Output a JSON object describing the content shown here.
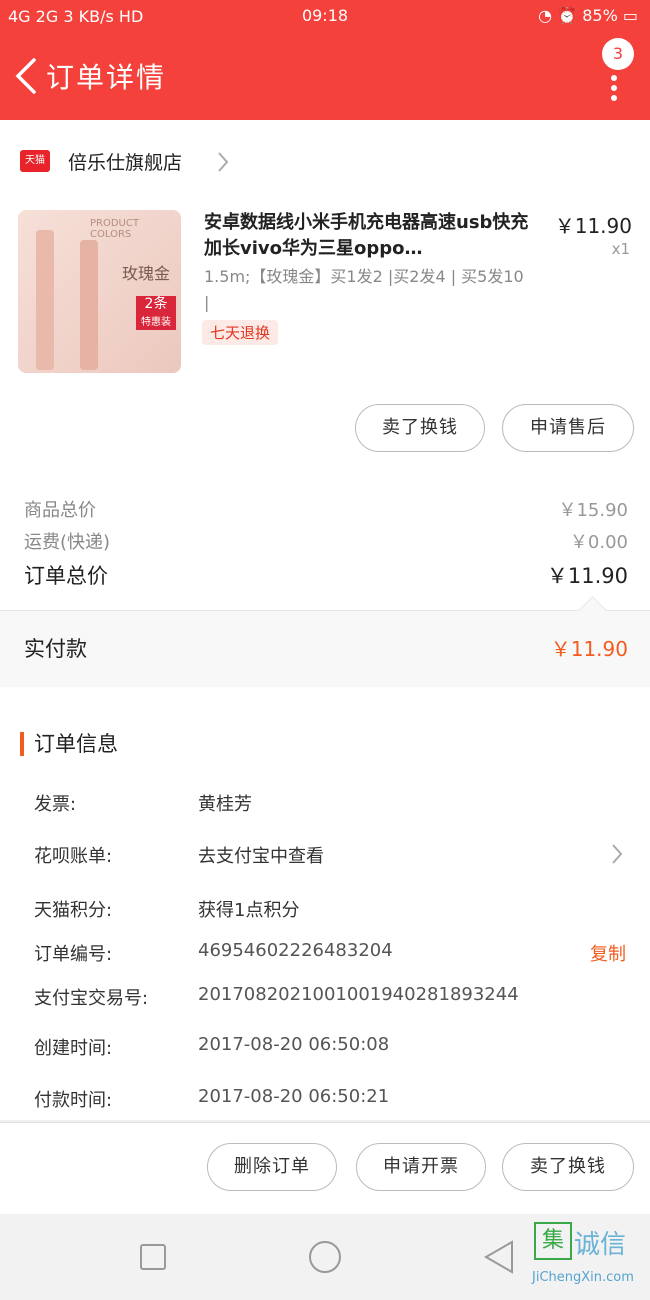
{
  "status_bar": {
    "network": "4G 2G",
    "speed": "3 KB/s",
    "hd": "HD",
    "time": "09:18",
    "battery": "85%"
  },
  "header": {
    "title": "订单详情",
    "badge_count": "3"
  },
  "shop": {
    "name": "倍乐仕旗舰店",
    "platform_tag": "天猫"
  },
  "product": {
    "name": "安卓数据线小米手机充电器高速usb快充加长vivo华为三星oppo…",
    "price": "￥11.90",
    "qty": "x1",
    "sku": "1.5m;【玫瑰金】买1发2 |买2发4 | 买5发10 |",
    "return_tag": "七天退换",
    "image": {
      "header": "PRODUCT COLORS",
      "color": "玫瑰金",
      "pack": "2条",
      "pack_sub": "特惠装"
    }
  },
  "actions": {
    "sell_button": "卖了换钱",
    "aftersale_button": "申请售后"
  },
  "summary": {
    "goods_total_label": "商品总价",
    "goods_total": "￥15.90",
    "shipping_label": "运费(快递)",
    "shipping": "￥0.00",
    "order_total_label": "订单总价",
    "order_total": "￥11.90",
    "paid_label": "实付款",
    "paid": "￥11.90"
  },
  "order_info": {
    "section_title": "订单信息",
    "invoice_label": "发票:",
    "invoice": "黄桂芳",
    "huabei_label": "花呗账单:",
    "huabei": "去支付宝中查看",
    "points_label": "天猫积分:",
    "points": "获得1点积分",
    "order_no_label": "订单编号:",
    "order_no": "46954602226483204",
    "copy": "复制",
    "alipay_label": "支付宝交易号:",
    "alipay_no": "2017082021001001940281893244",
    "created_label": "创建时间:",
    "created": "2017-08-20 06:50:08",
    "paid_time_label": "付款时间:",
    "paid_time": "2017-08-20 06:50:21"
  },
  "footer": {
    "delete": "删除订单",
    "invoice": "申请开票",
    "sell": "卖了换钱"
  },
  "watermark": {
    "char": "集",
    "text": "诚信",
    "url": "JiChengXin.com"
  },
  "colors": {
    "brand_red": "#f4413c",
    "accent_orange": "#f25c1f"
  }
}
